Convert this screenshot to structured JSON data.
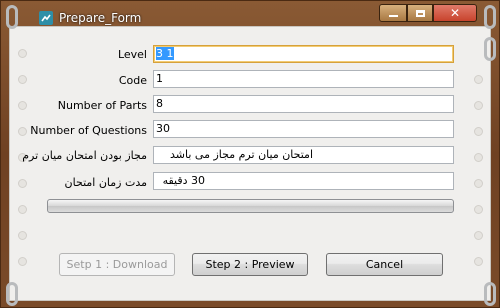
{
  "window": {
    "title": "Prepare_Form",
    "close_symbol": "✕"
  },
  "form": {
    "level": {
      "label": "Level",
      "value": "3 1"
    },
    "code": {
      "label": "Code",
      "value": "1"
    },
    "parts": {
      "label": "Number of Parts",
      "value": "8"
    },
    "questions": {
      "label": "Number of Questions",
      "value": "30"
    },
    "midterm": {
      "label": "مجاز بودن امتحان میان ترم",
      "value": "امتحان میان ترم مجاز می باشد"
    },
    "duration": {
      "label": "مدت زمان امتحان",
      "value": "30 دقیقه"
    }
  },
  "progress": {
    "fraction": 0
  },
  "buttons": {
    "step1": "Setp 1 : Download",
    "step2": "Step 2 : Preview",
    "cancel": "Cancel"
  },
  "colors": {
    "wood": "#7b4a28",
    "paper": "#f0efed",
    "close": "#c8432c"
  }
}
